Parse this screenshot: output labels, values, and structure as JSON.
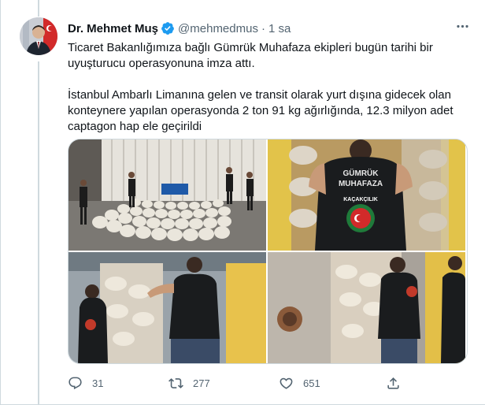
{
  "tweet": {
    "author_name": "Dr. Mehmet Muş",
    "handle": "@mehmedmus",
    "separator": "·",
    "time": "1 sa",
    "paragraphs": [
      "Ticaret Bakanlığımıza bağlı Gümrük Muhafaza ekipleri bugün tarihi bir\nuyuşturucu operasyonuna imza attı.",
      "İstanbul Ambarlı Limanına gelen ve transit olarak yurt dışına gidecek olan\nkonteynere yapılan operasyonda 2 ton 91 kg ağırlığında, 12.3 milyon adet\ncaptagon hap ele geçirildi"
    ]
  },
  "media": {
    "vest_text_line1": "GÜMRÜK",
    "vest_text_line2": "MUHAFAZA",
    "badge_text": "KAÇAKÇILIK",
    "icons": [
      "verified-badge-icon",
      "more-icon",
      "reply-icon",
      "retweet-icon",
      "like-icon",
      "share-icon"
    ]
  },
  "actions": {
    "replies": "31",
    "retweets": "277",
    "likes": "651"
  },
  "colors": {
    "text": "#0f1419",
    "muted": "#536471",
    "verified": "#1d9bf0",
    "border": "#cfd9de"
  }
}
